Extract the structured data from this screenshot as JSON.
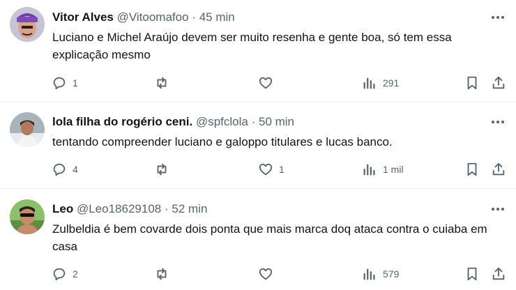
{
  "tweets": [
    {
      "name": "Vitor Alves",
      "handle": "@Vitoomafoo",
      "sep": "·",
      "time": "45 min",
      "text": "Luciano e Michel Araújo devem ser muito resenha e gente boa, só tem essa explicação mesmo",
      "replies": "1",
      "retweets": "",
      "likes": "",
      "views": "291"
    },
    {
      "name": "lola filha do rogério ceni.",
      "handle": "@spfclola",
      "sep": "·",
      "time": "50 min",
      "text": "tentando compreender luciano e galoppo titulares e lucas banco.",
      "replies": "4",
      "retweets": "",
      "likes": "1",
      "views": "1 mil"
    },
    {
      "name": "Leo",
      "handle": "@Leo18629108",
      "sep": "·",
      "time": "52 min",
      "text": "Zulbeldia é bem covarde dois ponta que mais marca doq ataca contra o cuiaba em casa",
      "replies": "2",
      "retweets": "",
      "likes": "",
      "views": "579"
    }
  ],
  "icons": {
    "more": "more-horizontal-icon",
    "reply": "reply-icon",
    "retweet": "retweet-icon",
    "like": "like-icon",
    "views": "views-icon",
    "bookmark": "bookmark-icon",
    "share": "share-icon"
  },
  "colors": {
    "text": "#0f1419",
    "secondary": "#536471",
    "divider": "#eff3f4"
  }
}
